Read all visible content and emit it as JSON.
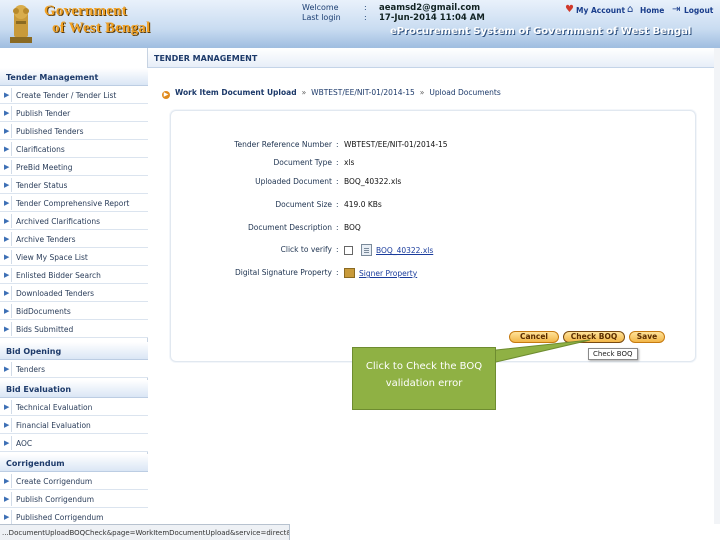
{
  "header": {
    "brand_line1": "Government",
    "brand_line2": "of West Bengal",
    "welcome_label": "Welcome",
    "welcome_value": "aeamsd2@gmail.com",
    "last_login_label": "Last login",
    "last_login_value": "17-Jun-2014 11:04 AM",
    "my_account": "My Account",
    "home": "Home",
    "logout": "Logout",
    "portal_title": "eProcurement System of Government of West Bengal",
    "separator": ":"
  },
  "sidebar": {
    "sections": [
      {
        "title": "Tender Management",
        "items": [
          "Create Tender / Tender List",
          "Publish Tender",
          "Published Tenders",
          "Clarifications",
          "PreBid Meeting",
          "Tender Status",
          "Tender Comprehensive Report",
          "Archived Clarifications",
          "Archive Tenders",
          "View My Space List",
          "Enlisted Bidder Search",
          "Downloaded Tenders",
          "BidDocuments",
          "Bids Submitted"
        ]
      },
      {
        "title": "Bid Opening",
        "items": [
          "Tenders"
        ]
      },
      {
        "title": "Bid Evaluation",
        "items": [
          "Technical Evaluation",
          "Financial Evaluation",
          "AOC"
        ]
      },
      {
        "title": "Corrigendum",
        "items": [
          "Create Corrigendum",
          "Publish Corrigendum",
          "Published Corrigendum"
        ]
      }
    ]
  },
  "main": {
    "section_title": "TENDER MANAGEMENT",
    "breadcrumb": [
      "Work Item Document Upload",
      "WBTEST/EE/NIT-01/2014-15",
      "Upload Documents"
    ],
    "breadcrumb_sep": "»",
    "fields": [
      {
        "label": "Tender Reference Number",
        "value": "WBTEST/EE/NIT-01/2014-15"
      },
      {
        "label": "Document Type",
        "value": "xls"
      },
      {
        "label": "Uploaded Document",
        "value": "BOQ_40322.xls"
      },
      {
        "label": "Document Size",
        "value": "419.0  KBs"
      },
      {
        "label": "Document Description",
        "value": "BOQ"
      },
      {
        "label": "Click to verify",
        "value": "BOQ_40322.xls"
      },
      {
        "label": "Digital Signature Property",
        "value": "Signer Property"
      }
    ],
    "buttons": {
      "cancel": "Cancel",
      "check_boq": "Check BOQ",
      "save": "Save"
    },
    "tooltip": "Check BOQ",
    "callout": "Click to Check the BOQ  validation error"
  },
  "status_bar": "...DocumentUploadBOQCheck&page=WorkItemDocumentUpload&service=direct&session=T",
  "colors": {
    "header_blue": "#9fbde0",
    "brand_orange": "#f1a124",
    "button_orange": "#f2b648",
    "callout_green": "#8fb144"
  }
}
